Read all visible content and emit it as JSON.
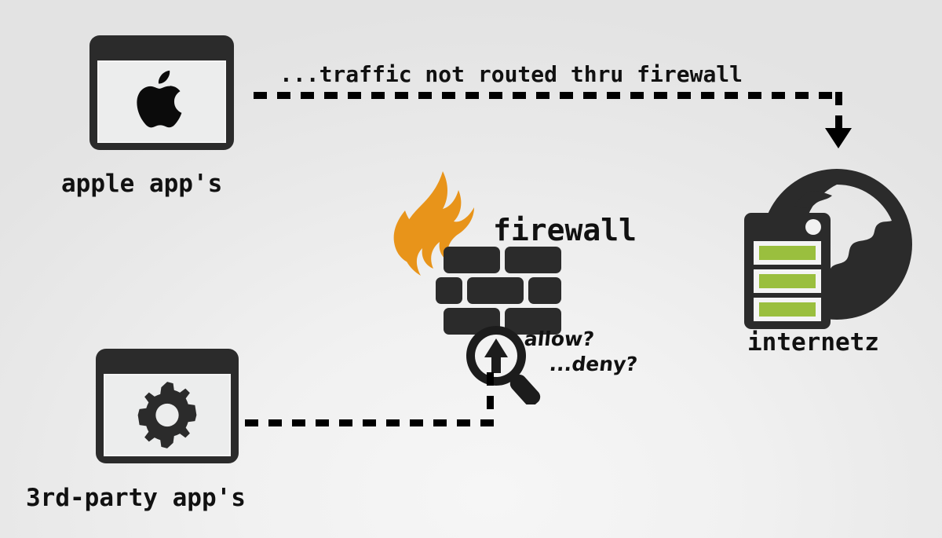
{
  "diagram": {
    "title": "macOS firewall traffic routing diagram",
    "background_color": "#eeeeee",
    "nodes": {
      "apple_apps": {
        "label": "apple app's",
        "icon": "apple-logo-window-icon",
        "frame_color": "#2b2b2b",
        "screen_color": "#eceded"
      },
      "third_party_apps": {
        "label": "3rd-party app's",
        "icon": "gear-window-icon",
        "frame_color": "#2b2b2b",
        "screen_color": "#eceded"
      },
      "firewall": {
        "label": "firewall",
        "icon": "firewall-brick-flame-icon",
        "flame_color": "#e8941a",
        "brick_color": "#2b2b2b",
        "inspect_icon": "magnifier-up-arrow-icon",
        "decision_line_1": "allow?",
        "decision_line_2": "...deny?"
      },
      "internetz": {
        "label": "internetz",
        "icon": "globe-server-icon",
        "globe_color": "#2b2b2b",
        "server_color": "#2b2b2b",
        "led_color": "#9abf3e",
        "led_count": 3
      }
    },
    "edges": {
      "bypass": {
        "label": "...traffic not routed thru firewall",
        "style": "dashed",
        "arrow": "arrow-down-icon",
        "from": "apple_apps",
        "to": "internetz"
      },
      "inspected": {
        "label": "",
        "style": "dashed",
        "from": "third_party_apps",
        "to": "firewall"
      }
    }
  }
}
